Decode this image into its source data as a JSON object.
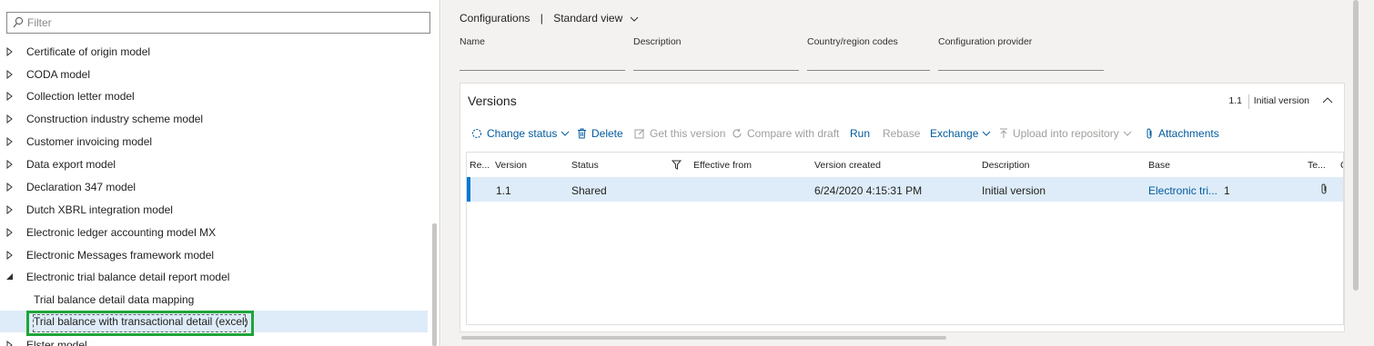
{
  "filter": {
    "placeholder": "Filter"
  },
  "tree": {
    "items": [
      {
        "label": "Certificate of origin model"
      },
      {
        "label": "CODA model"
      },
      {
        "label": "Collection letter model"
      },
      {
        "label": "Construction industry scheme model"
      },
      {
        "label": "Customer invoicing model"
      },
      {
        "label": "Data export model"
      },
      {
        "label": "Declaration 347 model"
      },
      {
        "label": "Dutch XBRL integration model"
      },
      {
        "label": "Electronic ledger accounting model MX"
      },
      {
        "label": "Electronic Messages framework model"
      },
      {
        "label": "Electronic trial balance detail report model"
      },
      {
        "label": "Trial balance detail data mapping"
      },
      {
        "label": "Trial balance with transactional detail (excel)"
      },
      {
        "label": "Elster model"
      }
    ]
  },
  "header": {
    "title": "Configurations",
    "separator": "|",
    "view": "Standard view"
  },
  "fields": {
    "name": "Name",
    "description": "Description",
    "country": "Country/region codes",
    "provider": "Configuration provider"
  },
  "versions": {
    "title": "Versions",
    "current_version": "1.1",
    "current_description": "Initial version",
    "toolbar": {
      "change_status": "Change status",
      "delete": "Delete",
      "get_version": "Get this version",
      "compare": "Compare with draft",
      "run": "Run",
      "rebase": "Rebase",
      "exchange": "Exchange",
      "upload": "Upload into repository",
      "attachments": "Attachments"
    },
    "columns": {
      "re": "Re...",
      "version": "Version",
      "status": "Status",
      "effective_from": "Effective from",
      "version_created": "Version created",
      "description": "Description",
      "base": "Base",
      "te": "Te...",
      "c": "C"
    },
    "rows": [
      {
        "version": "1.1",
        "status": "Shared",
        "version_created": "6/24/2020 4:15:31 PM",
        "description": "Initial version",
        "base": "Electronic tri...",
        "base_version": "1"
      }
    ]
  },
  "colors": {
    "accent": "#0078d4",
    "link": "#005a9e",
    "selected_row": "#deecf9",
    "highlight_box": "#1ea53a"
  }
}
